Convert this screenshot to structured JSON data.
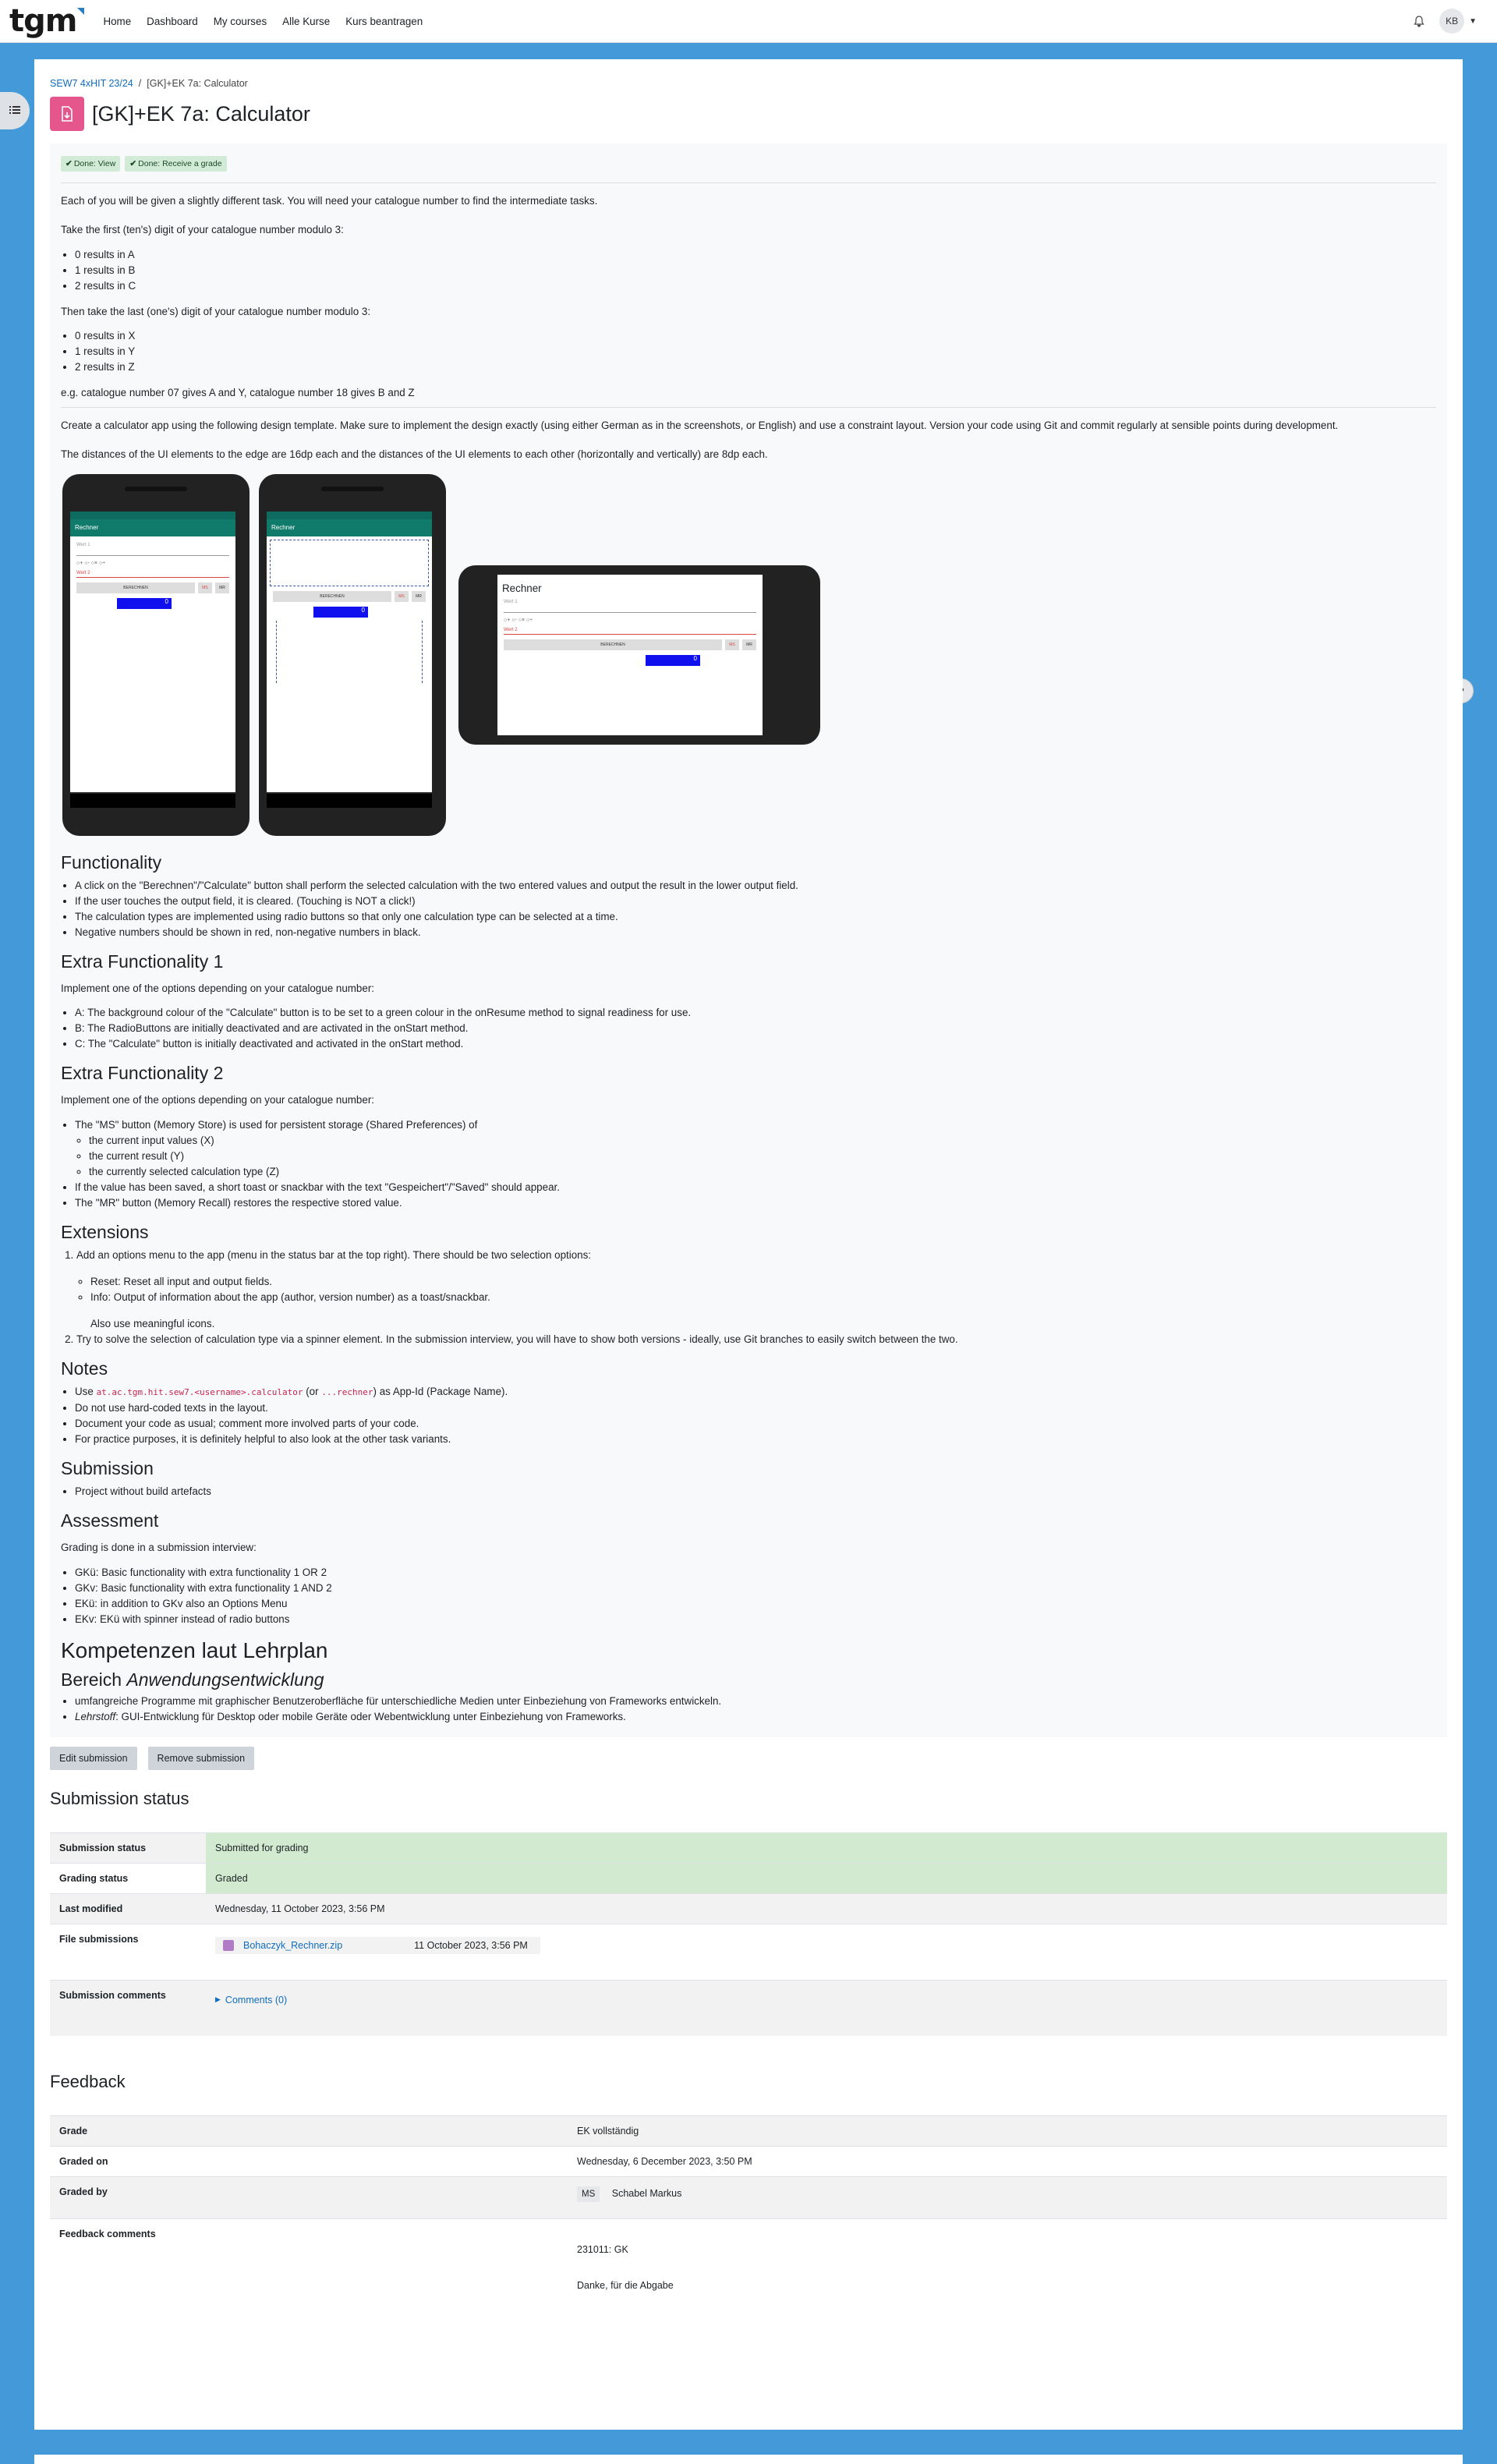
{
  "nav": {
    "logo": "tgm",
    "links": [
      "Home",
      "Dashboard",
      "My courses",
      "Alle Kurse",
      "Kurs beantragen"
    ],
    "avatar_initials": "KB"
  },
  "breadcrumb": {
    "course": "SEW7 4xHIT 23/24",
    "current": "[GK]+EK 7a: Calculator"
  },
  "title": "[GK]+EK 7a: Calculator",
  "badges": {
    "view": "Done: View",
    "grade": "Done: Receive a grade"
  },
  "intro": {
    "p1": "Each of you will be given a slightly different task. You will need your catalogue number to find the intermediate tasks.",
    "p2": "Take the first (ten's) digit of your catalogue number modulo 3:",
    "list1": [
      "0 results in A",
      "1 results in B",
      "2 results in C"
    ],
    "p3": "Then take the last (one's) digit of your catalogue number modulo 3:",
    "list2": [
      "0 results in X",
      "1 results in Y",
      "2 results in Z"
    ],
    "p4": "e.g. catalogue number 07 gives A and Y, catalogue number 18 gives B and Z",
    "p5": "Create a calculator app using the following design template. Make sure to implement the design exactly (using either German as in the screenshots, or English) and use a constraint layout. Version your code using Git and commit regularly at sensible points during development.",
    "p6": "The distances of the UI elements to the edge are 16dp each and the distances of the UI elements to each other (horizontally and vertically) are 8dp each."
  },
  "mockup": {
    "app_title": "Rechner",
    "wert1": "Wert 1",
    "wert2": "Wert 2",
    "calc_btn": "BERECHNEN",
    "ms": "MS",
    "mr": "MR",
    "output": "0"
  },
  "functionality": {
    "heading": "Functionality",
    "items": [
      "A click on the \"Berechnen\"/\"Calculate\" button shall perform the selected calculation with the two entered values and output the result in the lower output field.",
      "If the user touches the output field, it is cleared. (Touching is NOT a click!)",
      "The calculation types are implemented using radio buttons so that only one calculation type can be selected at a time.",
      "Negative numbers should be shown in red, non-negative numbers in black."
    ]
  },
  "extra1": {
    "heading": "Extra Functionality 1",
    "intro": "Implement one of the options depending on your catalogue number:",
    "items": [
      "A: The background colour of the \"Calculate\" button is to be set to a green colour in the onResume method to signal readiness for use.",
      "B: The RadioButtons are initially deactivated and are activated in the onStart method.",
      "C: The \"Calculate\" button is initially deactivated and activated in the onStart method."
    ]
  },
  "extra2": {
    "heading": "Extra Functionality 2",
    "intro": "Implement one of the options depending on your catalogue number:",
    "ms": "The \"MS\" button (Memory Store) is used for persistent storage (Shared Preferences) of",
    "sub": [
      "the current input values (X)",
      "the current result (Y)",
      "the currently selected calculation type (Z)"
    ],
    "saved": "If the value has been saved, a short toast or snackbar with the text \"Gespeichert\"/\"Saved\" should appear.",
    "mr": "The \"MR\" button (Memory Recall) restores the respective stored value."
  },
  "extensions": {
    "heading": "Extensions",
    "item1": "Add an options menu to the app (menu in the status bar at the top right). There should be two selection options:",
    "sub": [
      "Reset: Reset all input and output fields.",
      "Info: Output of information about the app (author, version number) as a toast/snackbar."
    ],
    "icons": "Also use meaningful icons.",
    "item2": "Try to solve the selection of calculation type via a spinner element. In the submission interview, you will have to show both versions - ideally, use Git branches to easily switch between the two."
  },
  "notes": {
    "heading": "Notes",
    "use": "Use",
    "code1": "at.ac.tgm.hit.sew7.<username>.calculator",
    "or": "(or",
    "code2": "...rechner",
    "as": ") as App-Id (Package Name).",
    "items": [
      "Do not use hard-coded texts in the layout.",
      "Document your code as usual; comment more involved parts of your code.",
      "For practice purposes, it is definitely helpful to also look at the other task variants."
    ]
  },
  "submission": {
    "heading": "Submission",
    "items": [
      "Project without build artefacts"
    ]
  },
  "assessment": {
    "heading": "Assessment",
    "intro": "Grading is done in a submission interview:",
    "items": [
      "GKü: Basic functionality with extra functionality 1 OR 2",
      "GKv: Basic functionality with extra functionality 1 AND 2",
      "EKü: in addition to GKv also an Options Menu",
      "EKv: EKü with spinner instead of radio buttons"
    ]
  },
  "kompetenzen": {
    "heading": "Kompetenzen laut Lehrplan",
    "sub_prefix": "Bereich",
    "sub_italic": "Anwendungsentwicklung",
    "item1": "umfangreiche Programme mit graphischer Benutzeroberfläche für unterschiedliche Medien unter Einbeziehung von Frameworks entwickeln.",
    "item2_label": "Lehrstoff",
    "item2": ": GUI-Entwicklung für Desktop oder mobile Geräte oder Webentwicklung unter Einbeziehung von Frameworks."
  },
  "buttons": {
    "edit": "Edit submission",
    "remove": "Remove submission"
  },
  "status": {
    "heading": "Submission status",
    "rows": {
      "submission_status": {
        "label": "Submission status",
        "value": "Submitted for grading"
      },
      "grading_status": {
        "label": "Grading status",
        "value": "Graded"
      },
      "last_modified": {
        "label": "Last modified",
        "value": "Wednesday, 11 October 2023, 3:56 PM"
      },
      "file_submissions": {
        "label": "File submissions",
        "file": "Bohaczyk_Rechner.zip",
        "date": "11 October 2023, 3:56 PM"
      },
      "comments": {
        "label": "Submission comments",
        "link": "Comments (0)"
      }
    }
  },
  "feedback": {
    "heading": "Feedback",
    "grade": {
      "label": "Grade",
      "value": "EK vollständig"
    },
    "graded_on": {
      "label": "Graded on",
      "value": "Wednesday, 6 December 2023, 3:50 PM"
    },
    "graded_by": {
      "label": "Graded by",
      "initials": "MS",
      "name": "Schabel Markus"
    },
    "comments": {
      "label": "Feedback comments",
      "line1": "231011: GK",
      "line2": "Danke, für die Abgabe"
    }
  },
  "colors": {
    "accent": "#0f6cbf",
    "background": "#449ad8",
    "assign_icon": "#e4568c",
    "success": "#d2ebd0"
  }
}
